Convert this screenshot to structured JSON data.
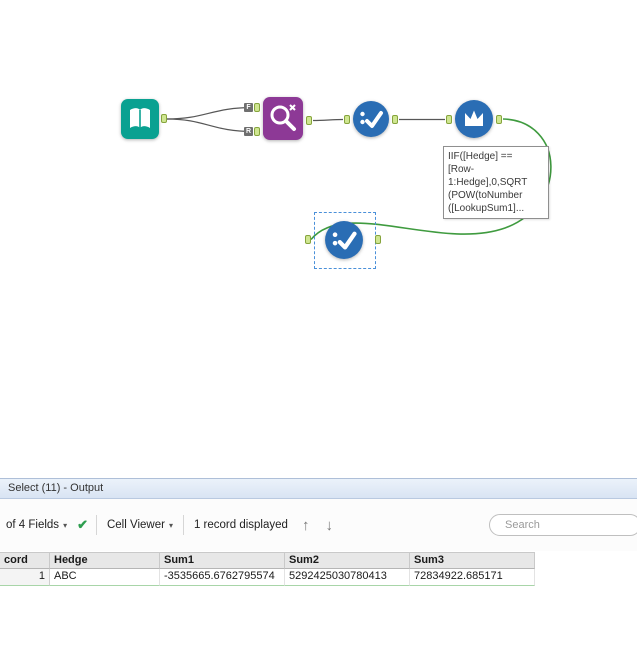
{
  "canvas": {
    "fr_labels": [
      "F",
      "R"
    ],
    "annotation_text": "IIF([Hedge] ==\n[Row-\n1:Hedge],0,SQRT\n(POW(toNumber\n([LookupSum1]..."
  },
  "icons": {
    "caret": "▾",
    "check": "✔",
    "up_arrow": "↑",
    "down_arrow": "↓"
  },
  "results": {
    "title": "Select (11) - Output",
    "toolbar": {
      "fields": "of 4 Fields",
      "cell_viewer": "Cell Viewer",
      "records": "1 record displayed",
      "search_placeholder": "Search"
    },
    "table": {
      "columns": [
        "cord",
        "Hedge",
        "Sum1",
        "Sum2",
        "Sum3"
      ],
      "rows": [
        [
          "1",
          "ABC",
          "-3535665.6762795574",
          "5292425030780413",
          "72834922.685171"
        ]
      ]
    }
  },
  "colors": {
    "tool_blue": "#2a6db4",
    "tool_teal": "#0aa191",
    "tool_purple": "#8d3996",
    "wire_green": "#3f9b3f",
    "anchor_fill": "#cfe691"
  }
}
